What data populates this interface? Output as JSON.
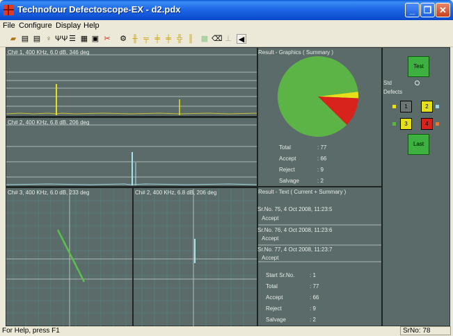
{
  "window": {
    "title": "Technofour Defectoscope-EX - d2.pdx",
    "icon": "app-logo-icon",
    "controls": [
      "minimize-icon",
      "maximize-icon",
      "close-icon"
    ]
  },
  "menu": [
    "File",
    "Configure",
    "Display",
    "Help"
  ],
  "toolbar": {
    "icons": [
      "open-icon",
      "print-icon",
      "print-preview-icon",
      "probe-icon",
      "calibrate-icon",
      "list-icon",
      "grid-icon",
      "report-icon",
      "tools-icon",
      "settings-icon",
      "vertical-gates-icon",
      "horizontal-gates-icon",
      "gate-align-icon",
      "gate-split-icon",
      "gate-cross-icon",
      "bar-icon",
      "image-icon",
      "eraser-icon",
      "baseline-icon",
      "speaker-icon"
    ]
  },
  "channels": {
    "ch1": {
      "title": "Ch# 1, 400 KHz, 6.0 dB, 346 deg"
    },
    "ch2a": {
      "title": "Ch# 2, 400 KHz, 6.8 dB, 206 deg"
    },
    "ch3": {
      "title": "Ch# 3, 400 KHz, 6.0 dB, 233 deg"
    },
    "ch2b": {
      "title": "Ch# 2, 400 KHz, 6.8 dB, 206 deg"
    }
  },
  "graphics": {
    "title": "Result - Graphics ( Summary )",
    "chart_data": {
      "type": "pie",
      "categories": [
        "Accept",
        "Reject",
        "Salvage"
      ],
      "values": [
        66,
        9,
        2
      ],
      "colors": [
        "#5cb447",
        "#d8221c",
        "#e6e01a"
      ]
    },
    "stats": [
      {
        "label": "Total",
        "value": ": 77"
      },
      {
        "label": "Accept",
        "value": ": 66"
      },
      {
        "label": "Reject",
        "value": ": 9"
      },
      {
        "label": "Salvage",
        "value": ": 2"
      }
    ]
  },
  "result_text": {
    "title": "Result - Text ( Current + Summary )",
    "entries": [
      {
        "line1": "Sr.No. 75,   4 Oct 2008, 11:23:5",
        "line2": "Accept"
      },
      {
        "line1": "Sr.No. 76,   4 Oct 2008, 11:23:6",
        "line2": "Accept"
      },
      {
        "line1": "Sr.No. 77,   4 Oct 2008, 11:23:7",
        "line2": "Accept"
      }
    ],
    "summary": [
      {
        "label": "Start Sr.No.",
        "value": ":  1"
      },
      {
        "label": "Total",
        "value": ":  77"
      },
      {
        "label": "Accept",
        "value": ":  66"
      },
      {
        "label": "Reject",
        "value": ":  9"
      },
      {
        "label": "Salvage",
        "value": ":  2"
      }
    ]
  },
  "controls": {
    "test_label": "Test",
    "std_label": "Std",
    "defects_label": "Defects",
    "last_label": "Last",
    "boxes": [
      {
        "label": "1",
        "color": "#6a7472",
        "marker": "#e6e01a"
      },
      {
        "label": "2",
        "color": "#e6e01a",
        "marker": "#9fd6e0"
      },
      {
        "label": "3",
        "color": "#e6e01a",
        "marker": "#5cb447"
      },
      {
        "label": "4",
        "color": "#d8221c",
        "marker": "#e07a3a"
      }
    ]
  },
  "status": {
    "help": "For Help, press F1",
    "srno": "SrNo: 78"
  }
}
